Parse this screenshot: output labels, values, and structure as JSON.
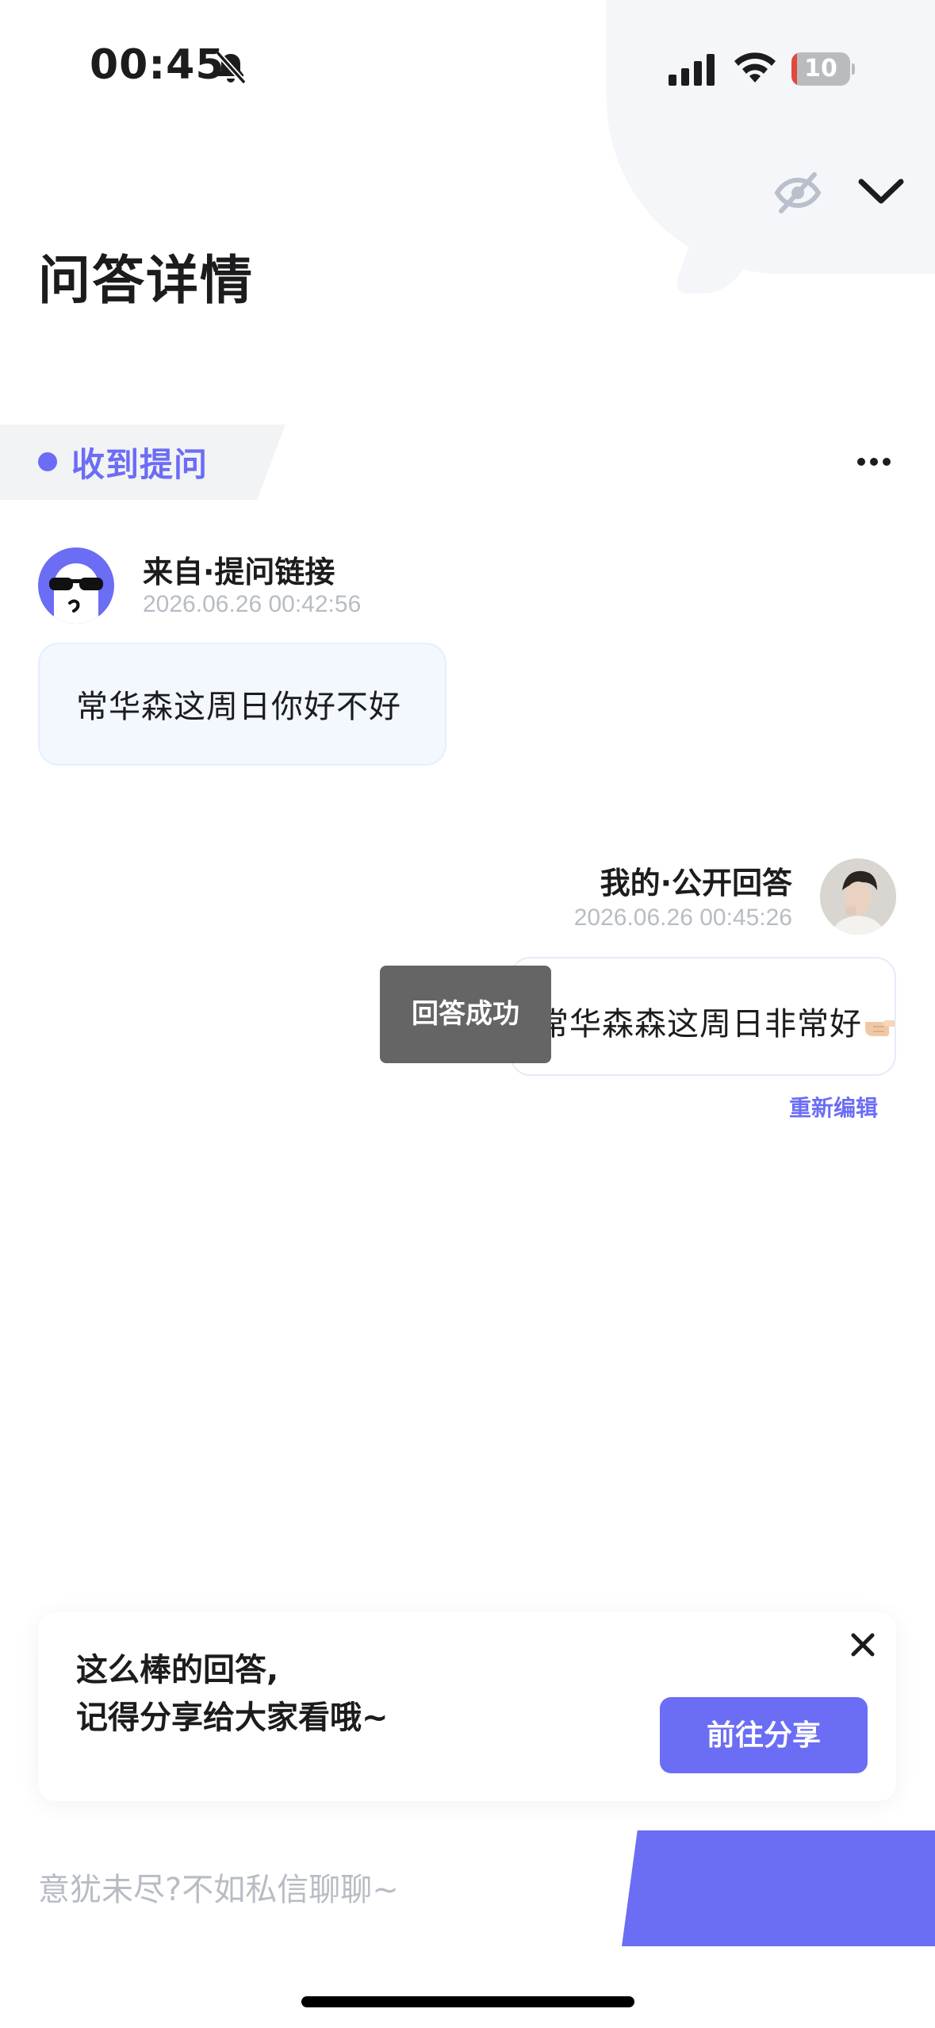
{
  "status_bar": {
    "time": "00:45",
    "battery": "10",
    "battery_level": 0.1
  },
  "header": {
    "title": "问答详情"
  },
  "section": {
    "tag_label": "收到提问"
  },
  "question": {
    "source": "来自·提问链接",
    "time": "2026.06.26 00:42:56",
    "text": "常华森这周日你好不好"
  },
  "answer": {
    "source": "我的·公开回答",
    "time": "2026.06.26 00:45:26",
    "text": "常华森森这周日非常好",
    "reedit_label": "重新编辑"
  },
  "toast": {
    "text": "回答成功"
  },
  "share_card": {
    "line1": "这么棒的回答,",
    "line2": "记得分享给大家看哦~",
    "button_label": "前往分享"
  },
  "bottom_bar": {
    "input_placeholder": "意犹未尽?不如私信聊聊~"
  },
  "icons": {
    "mute": "bell-slash-icon",
    "signal": "cellular-signal-icon",
    "wifi": "wifi-icon",
    "eye_off": "eye-off-icon",
    "collapse": "chevron-down-icon",
    "more": "more-dots-icon",
    "close": "close-icon",
    "hand": "pointing-hand-icon"
  },
  "colors": {
    "accent": "#6b6df5",
    "toast": "#656565",
    "bubble": "#f3f7fe",
    "muted_text": "#b8bcc4"
  }
}
